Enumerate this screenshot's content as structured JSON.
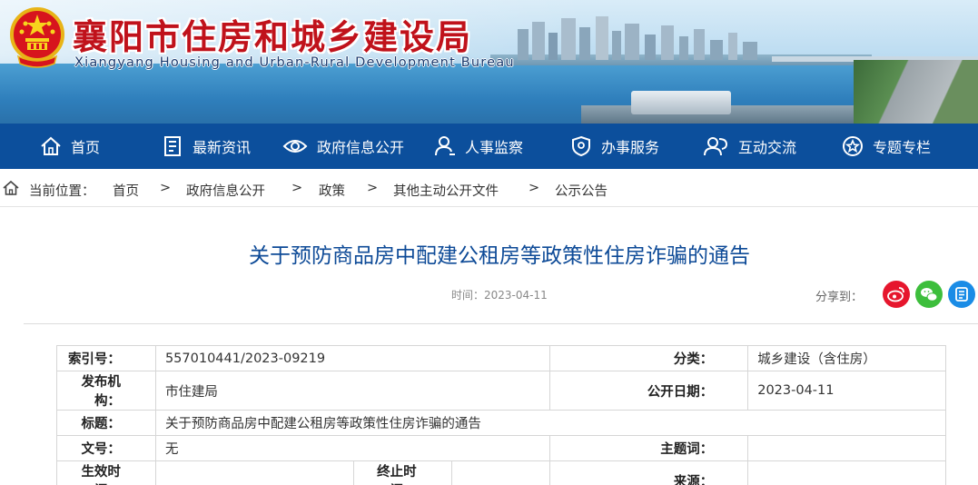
{
  "header": {
    "title": "襄阳市住房和城乡建设局",
    "subtitle": "Xiangyang  Housing and Urban-Rural Development Bureau"
  },
  "nav": {
    "items": [
      {
        "label": "首页",
        "icon": "home-icon"
      },
      {
        "label": "最新资讯",
        "icon": "news-icon"
      },
      {
        "label": "政府信息公开",
        "icon": "eye-icon"
      },
      {
        "label": "人事监察",
        "icon": "person-icon"
      },
      {
        "label": "办事服务",
        "icon": "shield-icon"
      },
      {
        "label": "互动交流",
        "icon": "chat-people-icon"
      },
      {
        "label": "专题专栏",
        "icon": "star-icon"
      }
    ]
  },
  "breadcrumb": {
    "prefix": "当前位置：",
    "separator": ">",
    "items": [
      "首页",
      "政府信息公开",
      "政策",
      "其他主动公开文件",
      "公示公告"
    ]
  },
  "article": {
    "title": "关于预防商品房中配建公租房等政策性住房诈骗的通告",
    "time": "时间：2023-04-11",
    "share_label": "分享到：",
    "share_icons": [
      "weibo-icon",
      "wechat-icon",
      "qzone-icon"
    ],
    "colors": {
      "weibo": "#e6162d",
      "wechat": "#3dbe3c",
      "qzone": "#1a8ce6"
    }
  },
  "info_table": {
    "index_label": "索引号：",
    "index_value": "557010441/2023-09219",
    "category_label": "分类：",
    "category_value": "城乡建设（含住房）",
    "publisher_label": "发布机构：",
    "publisher_value": "市住建局",
    "publish_date_label": "公开日期：",
    "publish_date_value": "2023-04-11",
    "title_label": "标题：",
    "title_value": "关于预防商品房中配建公租房等政策性住房诈骗的通告",
    "doc_no_label": "文号：",
    "doc_no_value": "无",
    "subject_label": "主题词：",
    "subject_value": "",
    "effective_label": "生效时间：",
    "effective_value": "",
    "expire_label": "终止时间：",
    "expire_value": "",
    "source_label": "来源：",
    "source_value": ""
  }
}
